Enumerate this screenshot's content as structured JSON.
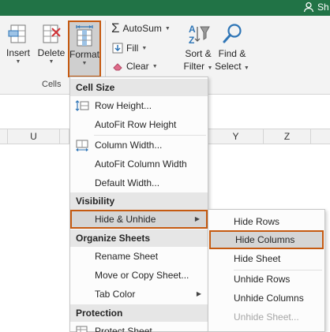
{
  "titlebar": {
    "share_label": "Sh"
  },
  "ribbon": {
    "cells_group": {
      "label": "Cells",
      "insert": "Insert",
      "delete": "Delete",
      "format": "Format"
    },
    "editing": {
      "autosum": "AutoSum",
      "fill": "Fill",
      "clear": "Clear",
      "sort_filter_line1": "Sort &",
      "sort_filter_line2": "Filter",
      "find_select_line1": "Find &",
      "find_select_line2": "Select"
    }
  },
  "grid": {
    "columns": [
      "U",
      "Y",
      "Z"
    ]
  },
  "format_menu": {
    "cell_size_header": "Cell Size",
    "row_height": "Row Height...",
    "autofit_row_height": "AutoFit Row Height",
    "column_width": "Column Width...",
    "autofit_column_width": "AutoFit Column Width",
    "default_width": "Default Width...",
    "visibility_header": "Visibility",
    "hide_unhide": "Hide & Unhide",
    "organize_header": "Organize Sheets",
    "rename_sheet": "Rename Sheet",
    "move_copy_sheet": "Move or Copy Sheet...",
    "tab_color": "Tab Color",
    "protection_header": "Protection",
    "protect_sheet": "Protect Sheet..."
  },
  "hide_unhide_submenu": {
    "hide_rows": "Hide Rows",
    "hide_columns": "Hide Columns",
    "hide_sheet": "Hide Sheet",
    "unhide_rows": "Unhide Rows",
    "unhide_columns": "Unhide Columns",
    "unhide_sheet": "Unhide Sheet..."
  },
  "colors": {
    "excel_green": "#217346",
    "highlight_border": "#c55a11"
  }
}
